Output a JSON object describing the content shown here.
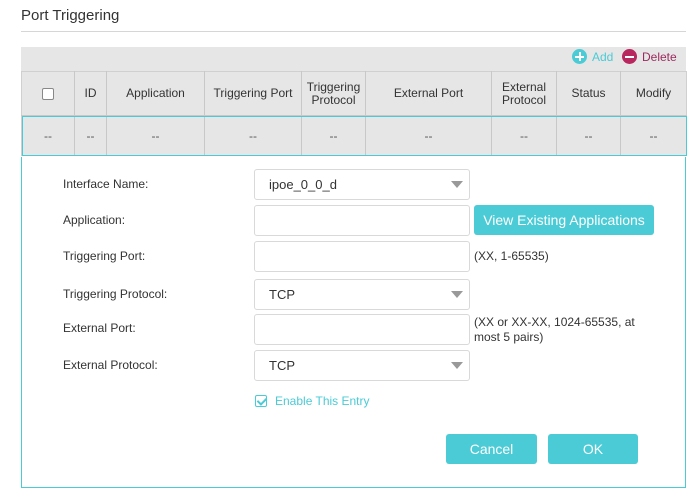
{
  "page": {
    "title": "Port Triggering"
  },
  "toolbar": {
    "add_label": "Add",
    "delete_label": "Delete"
  },
  "table": {
    "headers": [
      "ID",
      "Application",
      "Triggering Port",
      "Triggering Protocol",
      "External Port",
      "External Protocol",
      "Status",
      "Modify"
    ],
    "row": [
      "--",
      "--",
      "--",
      "--",
      "--",
      "--",
      "--",
      "--",
      "--"
    ]
  },
  "form": {
    "interface_label": "Interface Name:",
    "interface_value": "ipoe_0_0_d",
    "application_label": "Application:",
    "application_value": "",
    "view_apps_label": "View Existing Applications",
    "triggering_port_label": "Triggering Port:",
    "triggering_port_value": "",
    "triggering_port_hint": "(XX, 1-65535)",
    "triggering_protocol_label": "Triggering Protocol:",
    "triggering_protocol_value": "TCP",
    "external_port_label": "External Port:",
    "external_port_value": "",
    "external_port_hint_line1": "(XX or XX-XX, 1024-65535, at",
    "external_port_hint_line2": "most 5 pairs)",
    "external_protocol_label": "External Protocol:",
    "external_protocol_value": "TCP",
    "enable_label": "Enable This Entry",
    "enable_checked": true,
    "cancel_label": "Cancel",
    "ok_label": "OK"
  },
  "colors": {
    "accent": "#4acbd6",
    "delete": "#b8275d",
    "header_bg": "#e6e6e6"
  }
}
